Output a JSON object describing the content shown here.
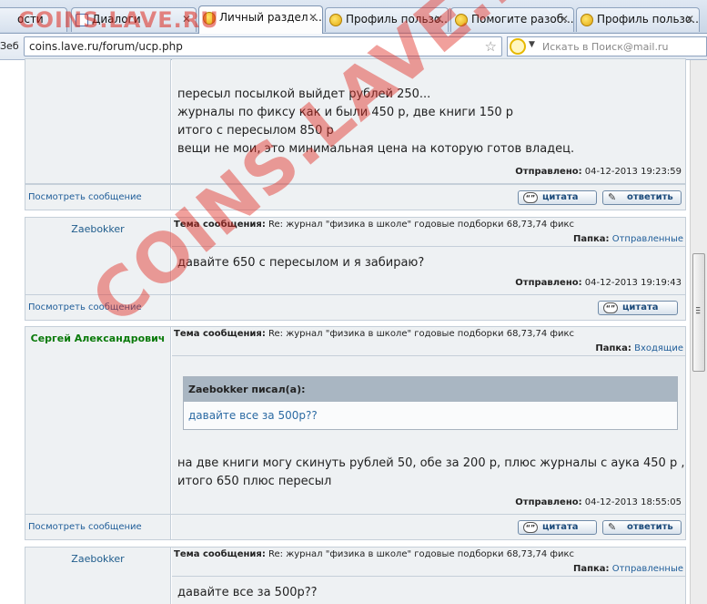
{
  "browser": {
    "tabs": [
      {
        "label": "ости",
        "icon": "none"
      },
      {
        "label": "Диалоги",
        "icon": "page-icon"
      },
      {
        "label": "Личный раздел ...",
        "icon": "smiley-icon",
        "active": true
      },
      {
        "label": "Профиль пользо...",
        "icon": "smiley-icon"
      },
      {
        "label": "Помогите разоб...",
        "icon": "smiley-icon"
      },
      {
        "label": "Профиль пользо...",
        "icon": "smiley-icon"
      }
    ],
    "nav_left": "Зеб",
    "url": "coins.lave.ru/forum/ucp.php",
    "search_placeholder": "Искать в Поиск@mail.ru"
  },
  "watermark": {
    "top": "COINS.LAVE.RU",
    "diagonal": "COINS.LAVE.RU"
  },
  "labels": {
    "view_message": "Посмотреть сообщение",
    "quote": "цитата",
    "reply": "ответить",
    "subject_prefix": "Тема сообщения:",
    "folder_prefix": "Папка:",
    "sent_prefix": "Отправлено:",
    "quote_wrote": "Zaebokker писал(а):"
  },
  "posts": [
    {
      "lines": [
        "пересыл посылкой выйдет рублей 250...",
        "журналы по фиксу как и были 450 р, две книги 150 р",
        "итого с пересылом 850 р",
        "вещи не мои, это минимальная цена на которую готов владец."
      ],
      "sent": "04-12-2013 19:23:59"
    },
    {
      "author": "Zaebokker",
      "subject": "Re: журнал \"физика в школе\" годовые подборки 68,73,74 фикс",
      "folder": "Отправленные",
      "lines": [
        "давайте 650 с пересылом и я забираю?"
      ],
      "sent": "04-12-2013 19:19:43"
    },
    {
      "author": "Сергей Александрович",
      "subject": "Re: журнал \"физика в школе\" годовые подборки 68,73,74 фикс",
      "folder": "Входящие",
      "quote": "давайте все за 500р??",
      "lines": [
        "на две книги могу скинуть рублей 50, обе за 200 р, плюс журналы с аука 450 р ,",
        "итого 650 плюс пересыл"
      ],
      "sent": "04-12-2013 18:55:05"
    },
    {
      "author": "Zaebokker",
      "subject": "Re: журнал \"физика в школе\" годовые подборки 68,73,74 фикс",
      "folder": "Отправленные",
      "lines": [
        "давайте все за 500р??"
      ]
    }
  ]
}
